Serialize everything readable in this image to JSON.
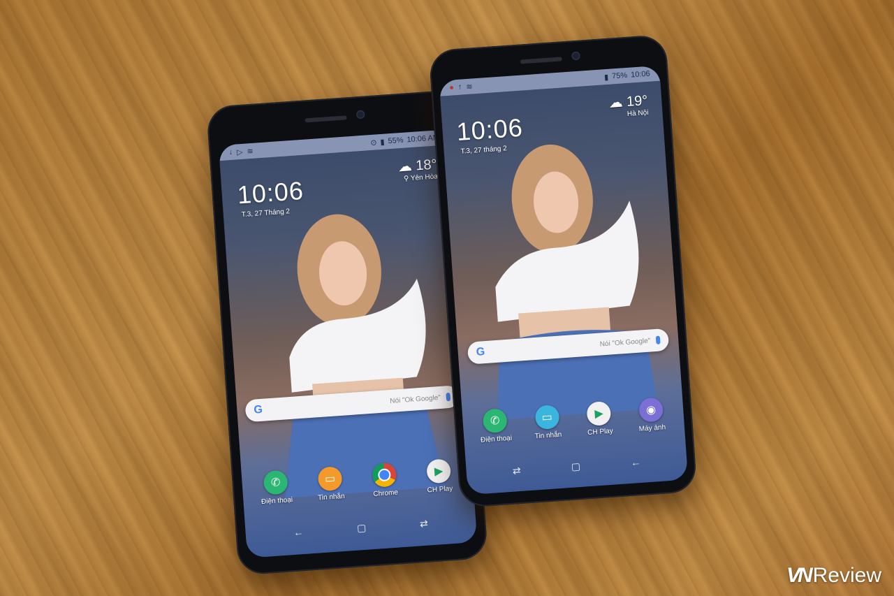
{
  "watermark": {
    "brand": "VN",
    "text": "Review"
  },
  "phones": [
    {
      "id": "left",
      "status": {
        "battery": "55%",
        "time": "10:06 AM"
      },
      "clock": "10:06",
      "date": "T.3, 27 Tháng 2",
      "weather": {
        "temp": "18°",
        "location": "Yên Hòa"
      },
      "search_hint": "Nói \"Ok Google\"",
      "apps": [
        {
          "label": "Điện thoại",
          "icon": "phone-icon",
          "color": "#2bb673"
        },
        {
          "label": "Tin nhắn",
          "icon": "message-icon",
          "color": "#f39a2b"
        },
        {
          "label": "Chrome",
          "icon": "chrome-icon",
          "color": "#e8e8e8"
        },
        {
          "label": "CH Play",
          "icon": "play-store-icon",
          "color": "#f1f1f1"
        }
      ]
    },
    {
      "id": "right",
      "status": {
        "battery": "75%",
        "time": "10:06"
      },
      "clock": "10:06",
      "date": "T.3, 27 tháng 2",
      "weather": {
        "temp": "19°",
        "location": "Hà Nội"
      },
      "search_hint": "Nói \"Ok Google\"",
      "apps": [
        {
          "label": "Điện thoại",
          "icon": "phone-icon",
          "color": "#2bb673"
        },
        {
          "label": "Tin nhắn",
          "icon": "message-icon",
          "color": "#3ab5e0"
        },
        {
          "label": "CH Play",
          "icon": "play-store-icon",
          "color": "#f1f1f1"
        },
        {
          "label": "Máy ảnh",
          "icon": "camera-icon",
          "color": "#7b6fd6"
        }
      ]
    }
  ]
}
